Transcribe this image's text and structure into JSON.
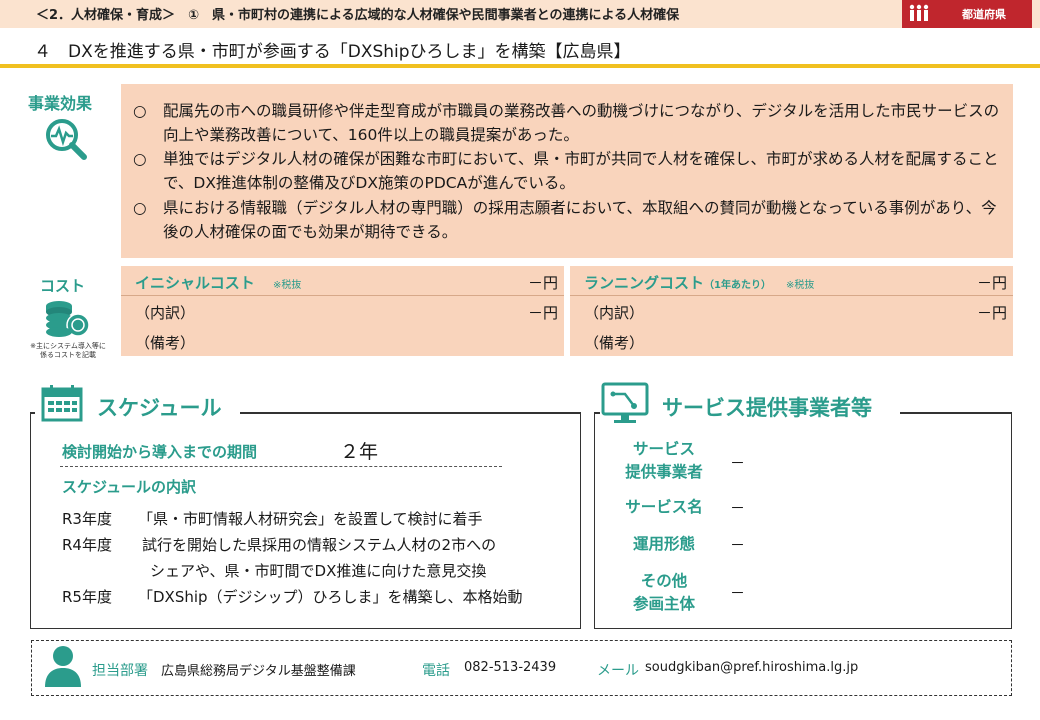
{
  "header": {
    "section_title": "＜2．人材確保・育成＞　①　県・市町村の連携による広域的な人材確保や民間事業者との連携による人材確保",
    "prefecture_tag": "都道府県"
  },
  "page_title": "４　DXを推進する県・市町が参画する「DXShipひろしま」を構築【広島県】",
  "effects": {
    "label": "事業効果",
    "bullet": "○",
    "items": [
      "配属先の市への職員研修や伴走型育成が市職員の業務改善への動機づけにつながり、デジタルを活用した市民サービスの向上や業務改善について、160件以上の職員提案があった。",
      "単独ではデジタル人材の確保が困難な市町において、県・市町が共同で人材を確保し、市町が求める人材を配属することで、DX推進体制の整備及びDX施策のPDCAが進んでいる。",
      "県における情報職（デジタル人材の専門職）の採用志願者において、本取組への賛同が動機となっている事例があり、今後の人材確保の面でも効果が期待できる。"
    ]
  },
  "cost": {
    "label": "コスト",
    "note": "※主にシステム導入等に係るコストを記載",
    "initial": {
      "name": "イニシャルコスト",
      "tax": "※税抜",
      "amount": "－円",
      "breakdown_label": "（内訳）",
      "breakdown_amount": "－円",
      "remarks_label": "（備考）"
    },
    "running": {
      "name": "ランニングコスト",
      "name_suffix": "（1年あたり）",
      "tax": "※税抜",
      "amount": "－円",
      "breakdown_label": "（内訳）",
      "breakdown_amount": "－円",
      "remarks_label": "（備考）"
    }
  },
  "schedule": {
    "title": "スケジュール",
    "period_label": "検討開始から導入までの期間",
    "period_value": "２年",
    "breakdown_label": "スケジュールの内訳",
    "rows": [
      {
        "year": "R3年度",
        "text": "「県・市町情報人材研究会」を設置して検討に着手"
      },
      {
        "year": "R4年度",
        "text": "試行を開始した県採用の情報システム人材の2市への"
      },
      {
        "year": "",
        "text": "シェアや、県・市町間でDX推進に向けた意見交換"
      },
      {
        "year": "R5年度",
        "text": "「DXShip（デジシップ）ひろしま」を構築し、本格始動"
      }
    ]
  },
  "service": {
    "title": "サービス提供事業者等",
    "rows": [
      {
        "label_1": "サービス",
        "label_2": "提供事業者",
        "value": "－"
      },
      {
        "label_1": "サービス名",
        "label_2": "",
        "value": "－"
      },
      {
        "label_1": "運用形態",
        "label_2": "",
        "value": "－"
      },
      {
        "label_1": "その他",
        "label_2": "参画主体",
        "value": "－"
      }
    ]
  },
  "contact": {
    "dept_label": "担当部署",
    "dept_value": "広島県総務局デジタル基盤整備課",
    "phone_label": "電話",
    "phone_value": "082-513-2439",
    "mail_label": "メール",
    "mail_value": "soudgkiban@pref.hiroshima.lg.jp"
  },
  "colors": {
    "accent": "#2b9c8c",
    "header_bg": "#fbe3cf",
    "box_bg": "#f9d4bc",
    "tag_red": "#c0262d",
    "rule_yellow": "#f0c020"
  }
}
